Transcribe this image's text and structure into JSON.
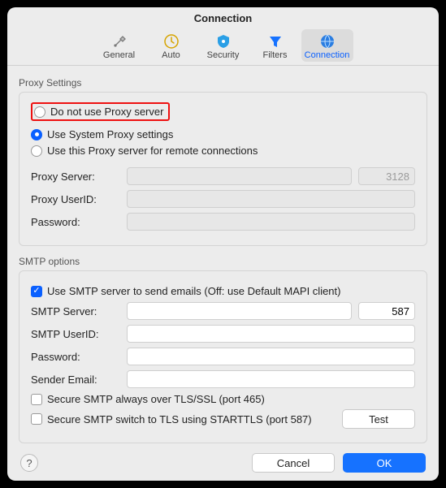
{
  "window": {
    "title": "Connection"
  },
  "tabs": {
    "general": "General",
    "auto": "Auto",
    "security": "Security",
    "filters": "Filters",
    "connection": "Connection"
  },
  "proxy": {
    "group_label": "Proxy Settings",
    "opt_none": "Do not use Proxy server",
    "opt_system": "Use System Proxy settings",
    "opt_custom": "Use this Proxy server for remote connections",
    "server_label": "Proxy Server:",
    "server_value": "",
    "port_value": "3128",
    "userid_label": "Proxy UserID:",
    "userid_value": "",
    "password_label": "Password:",
    "password_value": ""
  },
  "smtp": {
    "group_label": "SMTP options",
    "use_smtp": "Use SMTP server to send emails (Off: use Default MAPI client)",
    "server_label": "SMTP Server:",
    "server_value": "",
    "port_value": "587",
    "userid_label": "SMTP UserID:",
    "userid_value": "",
    "password_label": "Password:",
    "password_value": "",
    "sender_label": "Sender Email:",
    "sender_value": "",
    "secure_465": "Secure SMTP always over TLS/SSL (port 465)",
    "secure_587": "Secure SMTP switch to TLS using STARTTLS (port 587)",
    "test": "Test"
  },
  "footer": {
    "help": "?",
    "cancel": "Cancel",
    "ok": "OK"
  }
}
